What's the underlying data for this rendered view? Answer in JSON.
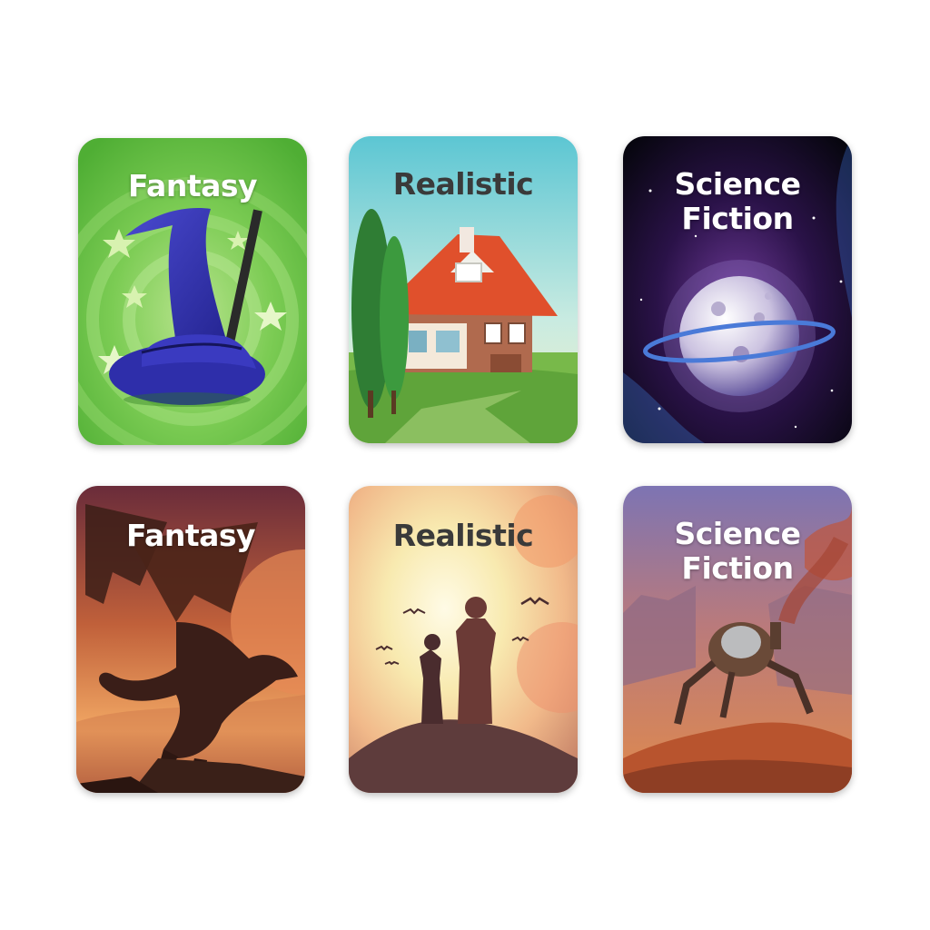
{
  "cards": [
    {
      "title": "Fantasy",
      "theme": "wizard-hat",
      "accent": "#6cc04a"
    },
    {
      "title": "Realistic",
      "theme": "house",
      "accent": "#5fc9d6"
    },
    {
      "title": "Science\nFiction",
      "theme": "planet",
      "accent": "#1a1030"
    },
    {
      "title": "Fantasy",
      "theme": "dragon",
      "accent": "#c0603a"
    },
    {
      "title": "Realistic",
      "theme": "silhouettes-sunset",
      "accent": "#f6e7a8"
    },
    {
      "title": "Science\nFiction",
      "theme": "robot-walker",
      "accent": "#8a7fb8"
    }
  ]
}
